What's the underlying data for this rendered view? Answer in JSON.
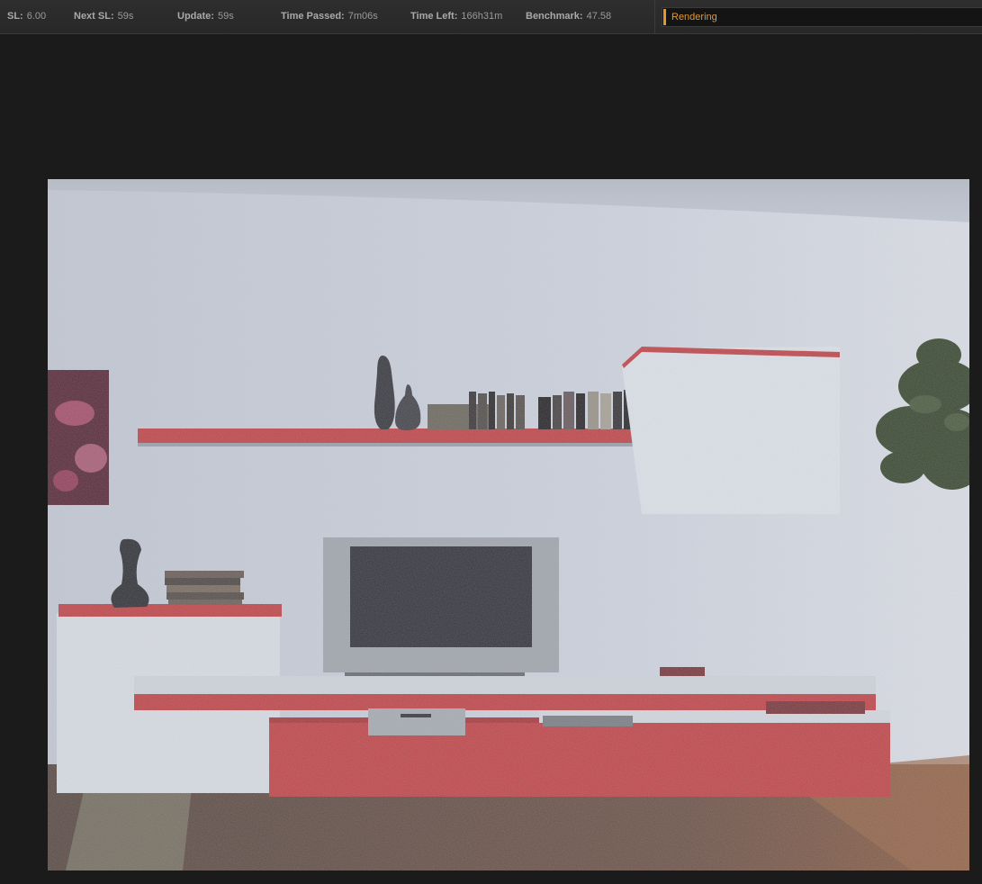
{
  "stats": [
    {
      "label": "SL:",
      "value": "6.00"
    },
    {
      "label": "Next SL:",
      "value": "59s"
    },
    {
      "label": "Update:",
      "value": "59s"
    },
    {
      "label": "Time Passed:",
      "value": "7m06s"
    },
    {
      "label": "Time Left:",
      "value": "166h31m"
    },
    {
      "label": "Benchmark:",
      "value": "47.58"
    }
  ],
  "status": {
    "text": "Rendering",
    "color": "#e8962b"
  },
  "render": {
    "subject": "living room wall unit with TV, shelves and plant (noisy progressive render)"
  }
}
